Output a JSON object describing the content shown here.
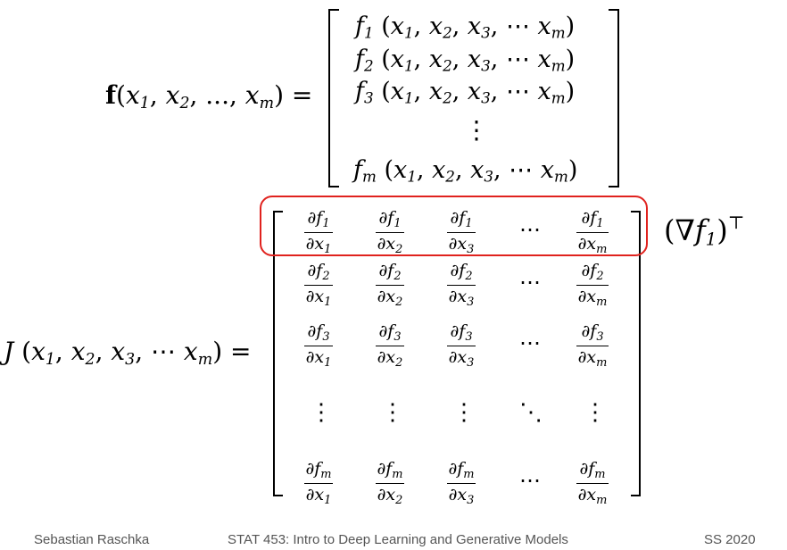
{
  "vector_function": {
    "lhs": "f(x₁, x₂, ..., xₘ) =",
    "rows": [
      "f₁ (x₁, x₂, x₃, ⋯ xₘ)",
      "f₂ (x₁, x₂, x₃, ⋯ xₘ)",
      "f₃ (x₁, x₂, x₃, ⋯ xₘ)",
      "⋮",
      "fₘ (x₁, x₂, x₃, ⋯ xₘ)"
    ]
  },
  "jacobian": {
    "lhs": "J (x₁, x₂, x₃, ⋯ xₘ) =",
    "columns": [
      "1",
      "2",
      "3",
      "⋯",
      "m"
    ],
    "rows": [
      "1",
      "2",
      "3",
      "⋮",
      "m"
    ],
    "highlight_label": "(∇f₁)ᵀ",
    "highlight_color": "#e0221e"
  },
  "footer": {
    "author": "Sebastian Raschka",
    "course": "STAT 453: Intro to Deep Learning and Generative Models",
    "term": "SS 2020"
  }
}
